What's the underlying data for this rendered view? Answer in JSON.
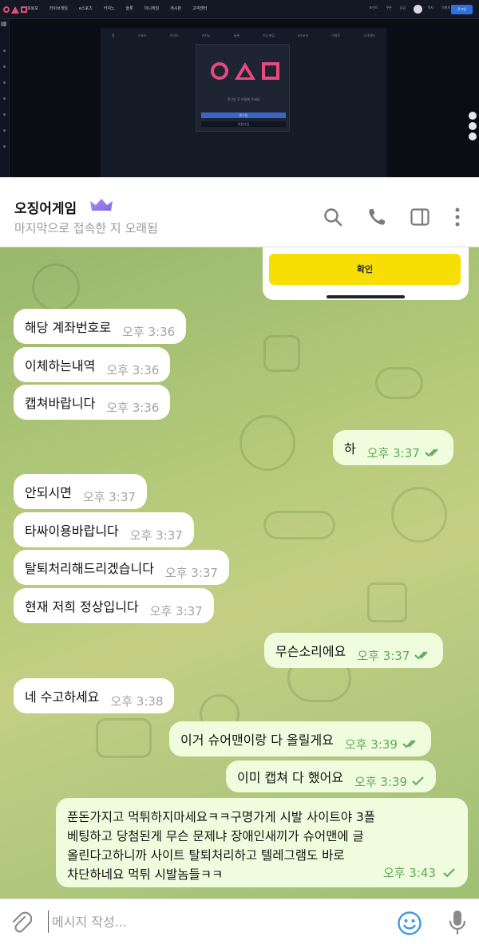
{
  "site": {
    "menu": [
      "프로모",
      "라이브게임",
      "e스포츠",
      "카지노",
      "슬롯",
      "미니게임",
      "게시판",
      "고객센터"
    ],
    "right_items": [
      "포인트",
      "쿠폰",
      "입금",
      "출금",
      "쪽지",
      "이벤트"
    ],
    "login_label": "로그인",
    "tabs": [
      "홈",
      "스포츠",
      "라이브",
      "카지노",
      "슬롯",
      "미니게임",
      "e스포츠",
      "이벤트",
      "고객센터"
    ],
    "modal_message": "로그인 후 이용해 주세요",
    "modal_primary": "로그인",
    "modal_secondary": "회원가입"
  },
  "header": {
    "title": "오징어게임",
    "status": "마지막으로 접속한 지 오래됨",
    "icons": [
      "search-icon",
      "phone-icon",
      "sidebar-icon",
      "more-icon"
    ]
  },
  "card": {
    "confirm_label": "확인"
  },
  "messages": [
    {
      "dir": "in",
      "text": "해당 계좌번호로",
      "time": "오후 3:36"
    },
    {
      "dir": "in",
      "text": "이체하는내역",
      "time": "오후 3:36"
    },
    {
      "dir": "in",
      "text": "캡쳐바랍니다",
      "time": "오후 3:36"
    },
    {
      "dir": "out",
      "text": "하",
      "time": "오후 3:37",
      "status": "read"
    },
    {
      "dir": "in",
      "text": "안되시면",
      "time": "오후 3:37"
    },
    {
      "dir": "in",
      "text": "타싸이용바랍니다",
      "time": "오후 3:37"
    },
    {
      "dir": "in",
      "text": "탈퇴처리해드리겠습니다",
      "time": "오후 3:37"
    },
    {
      "dir": "in",
      "text": "현재 저희 정상입니다",
      "time": "오후 3:37"
    },
    {
      "dir": "out",
      "text": "무슨소리에요",
      "time": "오후 3:37",
      "status": "read"
    },
    {
      "dir": "in",
      "text": "네 수고하세요",
      "time": "오후 3:38"
    },
    {
      "dir": "out",
      "text": "이거 슈어맨이랑 다 올릴게요",
      "time": "오후 3:39",
      "status": "read"
    },
    {
      "dir": "out",
      "text": "이미 캡쳐 다 했어요",
      "time": "오후 3:39",
      "status": "sent"
    }
  ],
  "long_message": {
    "lines": [
      "푼돈가지고 먹튀하지마세요ㅋㅋ구명가게 시발 사이트야 3폴",
      "베팅하고 당첨된게 무슨 문제냐 장애인새끼가 슈어맨에 글",
      "올린다고하니까 사이트 탈퇴처리하고 텔레그램도 바로",
      "차단하네요 먹튀 시발놈들ㅋㅋ"
    ],
    "time": "오후 3:43",
    "status": "sent"
  },
  "input": {
    "placeholder": "메시지 작성..."
  },
  "colors": {
    "logo_pink": "#e84a7f",
    "confirm_yellow": "#f7de05",
    "out_bubble": "#effdde",
    "check_green": "#5fa858",
    "emoji_blue": "#3f9ae0"
  }
}
